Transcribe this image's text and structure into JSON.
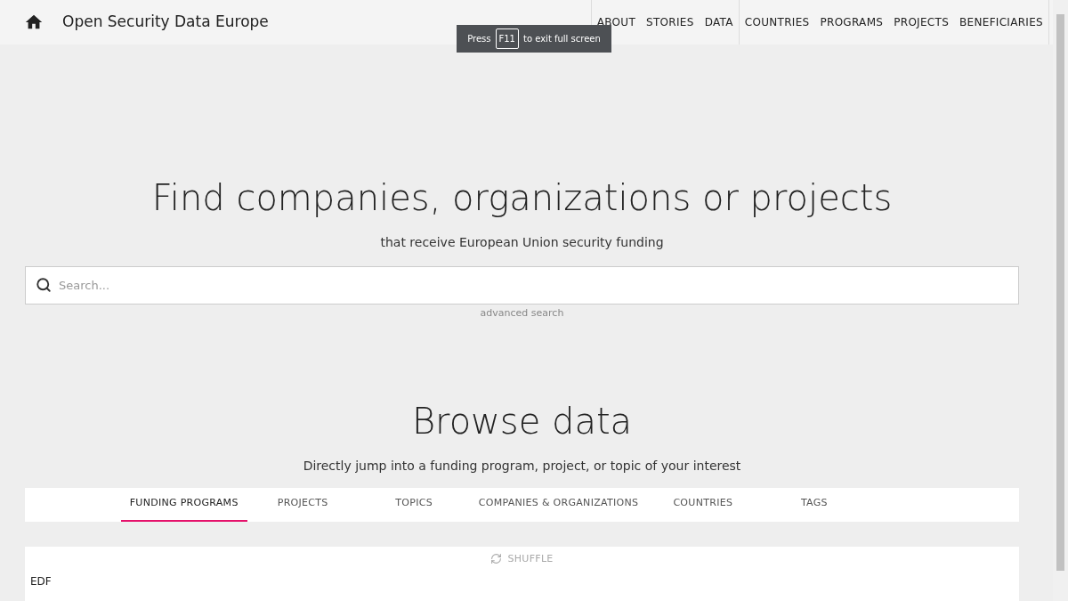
{
  "header": {
    "title": "Open Security Data Europe",
    "nav_groups": [
      [
        "ABOUT",
        "STORIES",
        "DATA"
      ],
      [
        "COUNTRIES",
        "PROGRAMS",
        "PROJECTS",
        "BENEFICIARIES"
      ]
    ]
  },
  "toast": {
    "before": "Press",
    "key": "F11",
    "after": "to exit full screen"
  },
  "hero": {
    "heading": "Find companies, organizations or projects",
    "subheading": "that receive European Union security funding",
    "search": {
      "placeholder": "Search..."
    },
    "advanced_link": "advanced search"
  },
  "browse": {
    "heading": "Browse data",
    "subheading": "Directly jump into a funding program, project, or topic of your interest",
    "tabs": [
      {
        "label": "FUNDING PROGRAMS",
        "selected": true
      },
      {
        "label": "PROJECTS",
        "selected": false
      },
      {
        "label": "TOPICS",
        "selected": false
      },
      {
        "label": "COMPANIES & ORGANIZATIONS",
        "selected": false
      },
      {
        "label": "COUNTRIES",
        "selected": false
      },
      {
        "label": "TAGS",
        "selected": false
      }
    ],
    "shuffle": "SHUFFLE",
    "first_item": "EDF"
  }
}
